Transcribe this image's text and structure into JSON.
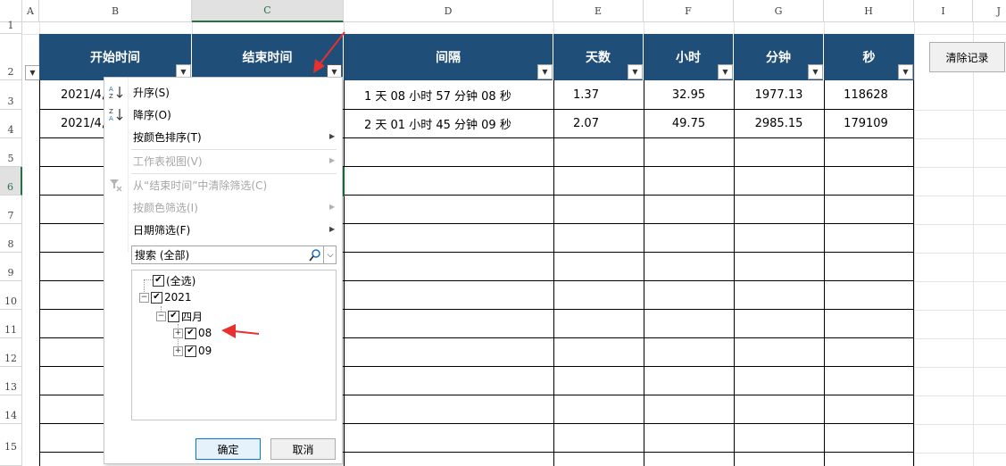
{
  "columns": [
    "A",
    "B",
    "C",
    "D",
    "E",
    "F",
    "G",
    "H",
    "I",
    "J"
  ],
  "rows": [
    "1",
    "2",
    "3",
    "4",
    "5",
    "6",
    "7",
    "8",
    "9",
    "10",
    "11",
    "12",
    "13",
    "14",
    "15"
  ],
  "table_headers": [
    "开始时间",
    "结束时间",
    "间隔",
    "天数",
    "小时",
    "分钟",
    "秒"
  ],
  "data_rows": [
    {
      "start": "2021/4,",
      "interval": "1 天 08 小时 57 分钟 08 秒",
      "days": "1.37",
      "hours": "32.95",
      "minutes": "1977.13",
      "seconds": "118628"
    },
    {
      "start": "2021/4,",
      "interval": "2 天 01 小时 45 分钟 09 秒",
      "days": "2.07",
      "hours": "49.75",
      "minutes": "2985.15",
      "seconds": "179109"
    }
  ],
  "clear_button": "清除记录",
  "menu": {
    "sort_asc": "升序(S)",
    "sort_desc": "降序(O)",
    "sort_color": "按颜色排序(T)",
    "sheet_view": "工作表视图(V)",
    "clear_filter": "从“结束时间”中清除筛选(C)",
    "filter_color": "按颜色筛选(I)",
    "date_filter": "日期筛选(F)",
    "search_placeholder": "搜索 (全部)",
    "tree": {
      "select_all": "(全选)",
      "year": "2021",
      "month": "四月",
      "day1": "08",
      "day2": "09"
    },
    "ok": "确定",
    "cancel": "取消"
  },
  "icons": {
    "sort_asc": "sort-asc-icon",
    "sort_desc": "sort-desc-icon",
    "clear_filter": "filter-clear-icon",
    "search": "search-icon"
  },
  "colors": {
    "header_bg": "#1f4e79",
    "selection": "#217346",
    "annotation_arrow": "#e8312f"
  }
}
